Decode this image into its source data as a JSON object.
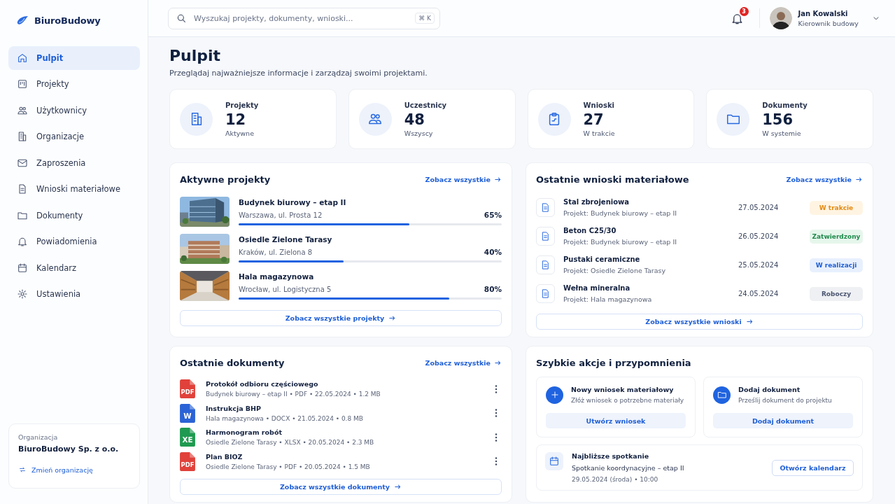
{
  "brand": {
    "name": "BiuroBudowy"
  },
  "nav": [
    {
      "label": "Pulpit",
      "kind": "home",
      "selected": true
    },
    {
      "label": "Projekty",
      "kind": "board",
      "selected": false
    },
    {
      "label": "Użytkownicy",
      "kind": "users",
      "selected": false
    },
    {
      "label": "Organizacje",
      "kind": "building",
      "selected": false
    },
    {
      "label": "Zaproszenia",
      "kind": "mail",
      "selected": false
    },
    {
      "label": "Wnioski materiałowe",
      "kind": "doc",
      "selected": false
    },
    {
      "label": "Dokumenty",
      "kind": "folder",
      "selected": false
    },
    {
      "label": "Powiadomienia",
      "kind": "bell",
      "selected": false
    },
    {
      "label": "Kalendarz",
      "kind": "calendar",
      "selected": false
    },
    {
      "label": "Ustawienia",
      "kind": "gear",
      "selected": false
    }
  ],
  "organization": {
    "label": "Organizacja",
    "name": "BiuroBudowy Sp. z o.o.",
    "switch": "Zmień organizację"
  },
  "search": {
    "placeholder": "Wyszukaj projekty, dokumenty, wnioski...",
    "shortcut": "⌘ K"
  },
  "notifications": {
    "count": "3"
  },
  "user": {
    "name": "Jan Kowalski",
    "role": "Kierownik budowy"
  },
  "page": {
    "title": "Pulpit",
    "subtitle": "Przeglądaj najważniejsze informacje i zarządzaj swoimi projektami."
  },
  "stats": [
    {
      "label": "Projekty",
      "value": "12",
      "note": "Aktywne",
      "kind": "building"
    },
    {
      "label": "Uczestnicy",
      "value": "48",
      "note": "Wszyscy",
      "kind": "users"
    },
    {
      "label": "Wnioski",
      "value": "27",
      "note": "W trakcie",
      "kind": "clipboard"
    },
    {
      "label": "Dokumenty",
      "value": "156",
      "note": "W systemie",
      "kind": "folder"
    }
  ],
  "projects": {
    "title": "Aktywne projekty",
    "link": "Zobacz wszystkie",
    "footer": "Zobacz wszystkie projekty",
    "items": [
      {
        "name": "Budynek biurowy – etap II",
        "address": "Warszawa, ul. Prosta 12",
        "percent": "65%",
        "level": 0.65
      },
      {
        "name": "Osiedle Zielone Tarasy",
        "address": "Kraków, ul. Zielona 8",
        "percent": "40%",
        "level": 0.4
      },
      {
        "name": "Hala magazynowa",
        "address": "Wrocław, ul. Logistyczna 5",
        "percent": "80%",
        "level": 0.8
      }
    ]
  },
  "requests": {
    "title": "Ostatnie wnioski materiałowe",
    "link": "Zobacz wszystkie",
    "footer": "Zobacz wszystkie wnioski",
    "items": [
      {
        "name": "Stal zbrojeniowa",
        "project": "Projekt: Budynek biurowy – etap II",
        "date": "27.05.2024",
        "status": "W trakcie",
        "kind": "progress"
      },
      {
        "name": "Beton C25/30",
        "project": "Projekt: Budynek biurowy – etap II",
        "date": "26.05.2024",
        "status": "Zatwierdzony",
        "kind": "approved"
      },
      {
        "name": "Pustaki ceramiczne",
        "project": "Projekt: Osiedle Zielone Tarasy",
        "date": "25.05.2024",
        "status": "W realizacji",
        "kind": "realization"
      },
      {
        "name": "Wełna mineralna",
        "project": "Projekt: Hala magazynowa",
        "date": "24.05.2024",
        "status": "Roboczy",
        "kind": "draft"
      }
    ]
  },
  "documents": {
    "title": "Ostatnie dokumenty",
    "link": "Zobacz wszystkie",
    "footer": "Zobacz wszystkie dokumenty",
    "items": [
      {
        "name": "Protokół odbioru częściowego",
        "meta": "Budynek biurowy – etap II • PDF • 22.05.2024 • 1.2 MB",
        "kind": "pdf",
        "mark": "PDF"
      },
      {
        "name": "Instrukcja BHP",
        "meta": "Hala magazynowa • DOCX • 21.05.2024 • 0.8 MB",
        "kind": "docx",
        "mark": "W"
      },
      {
        "name": "Harmonogram robót",
        "meta": "Osiedle Zielone Tarasy • XLSX • 20.05.2024 • 2.3 MB",
        "kind": "xlsx",
        "mark": "XE"
      },
      {
        "name": "Plan BIOZ",
        "meta": "Osiedle Zielone Tarasy • PDF • 20.05.2024 • 1.5 MB",
        "kind": "pdf",
        "mark": "PDF"
      }
    ]
  },
  "quick": {
    "title": "Szybkie akcje i przypomnienia",
    "actions": [
      {
        "title": "Nowy wniosek materiałowy",
        "description": "Złóż wniosek o potrzebne materiały",
        "button": "Utwórz wniosek",
        "kind": "plus"
      },
      {
        "title": "Dodaj dokument",
        "description": "Prześlij dokument do projektu",
        "button": "Dodaj dokument",
        "kind": "folder"
      }
    ],
    "meeting": {
      "title": "Najbliższe spotkanie",
      "name": "Spotkanie koordynacyjne – etap II",
      "when": "29.05.2024 (środa) • 10:00",
      "button": "Otwórz kalendarz"
    }
  }
}
